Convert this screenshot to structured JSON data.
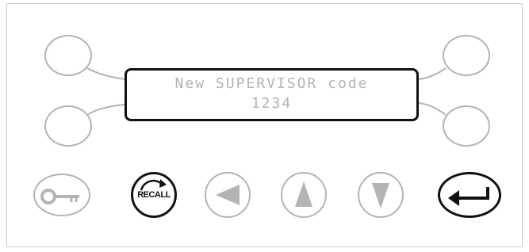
{
  "lcd": {
    "line1": "New SUPERVISOR code",
    "line2": "1234"
  },
  "buttons": {
    "key": {
      "icon": "key-icon"
    },
    "recall": {
      "label": "RECALL",
      "icon": "recall-arrow-icon"
    },
    "left": {
      "icon": "left-arrow-icon"
    },
    "up": {
      "icon": "up-arrow-icon"
    },
    "down": {
      "icon": "down-arrow-icon"
    },
    "enter": {
      "icon": "enter-return-icon"
    }
  },
  "softkeys": [
    "top-left",
    "bottom-left",
    "top-right",
    "bottom-right"
  ],
  "colors": {
    "inactive": "#b4b4b4",
    "active": "#111111",
    "panel_border": "#c8c8c8"
  }
}
